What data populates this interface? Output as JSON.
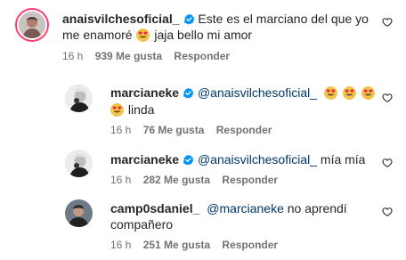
{
  "comments": [
    {
      "username": "anaisvilchesoficial_",
      "text_1": "Este es el marciano del que yo",
      "text_2a": "me enamoré",
      "text_2b": "jaja bello mi amor",
      "time": "16 h",
      "likes": "939 Me gusta",
      "reply": "Responder"
    },
    {
      "username": "marcianeke",
      "mention": "@anaisvilchesoficial_",
      "text_2": "linda",
      "time": "16 h",
      "likes": "76 Me gusta",
      "reply": "Responder"
    },
    {
      "username": "marcianeke",
      "mention": "@anaisvilchesoficial_",
      "text": "mía mía",
      "time": "16 h",
      "likes": "282 Me gusta",
      "reply": "Responder"
    },
    {
      "username": "camp0sdaniel_",
      "mention": "@marcianeke",
      "text": "no aprendí",
      "text_2": "compañero",
      "time": "16 h",
      "likes": "251 Me gusta",
      "reply": "Responder"
    }
  ],
  "icons": {
    "heart": "heart-outline-icon",
    "verified": "verified-badge-icon",
    "emoji": "smiling-face-with-heart-eyes"
  },
  "colors": {
    "verified": "#0095f6",
    "mention": "#00376b",
    "meta": "#737373",
    "story_ring": "#ff3a6e"
  }
}
